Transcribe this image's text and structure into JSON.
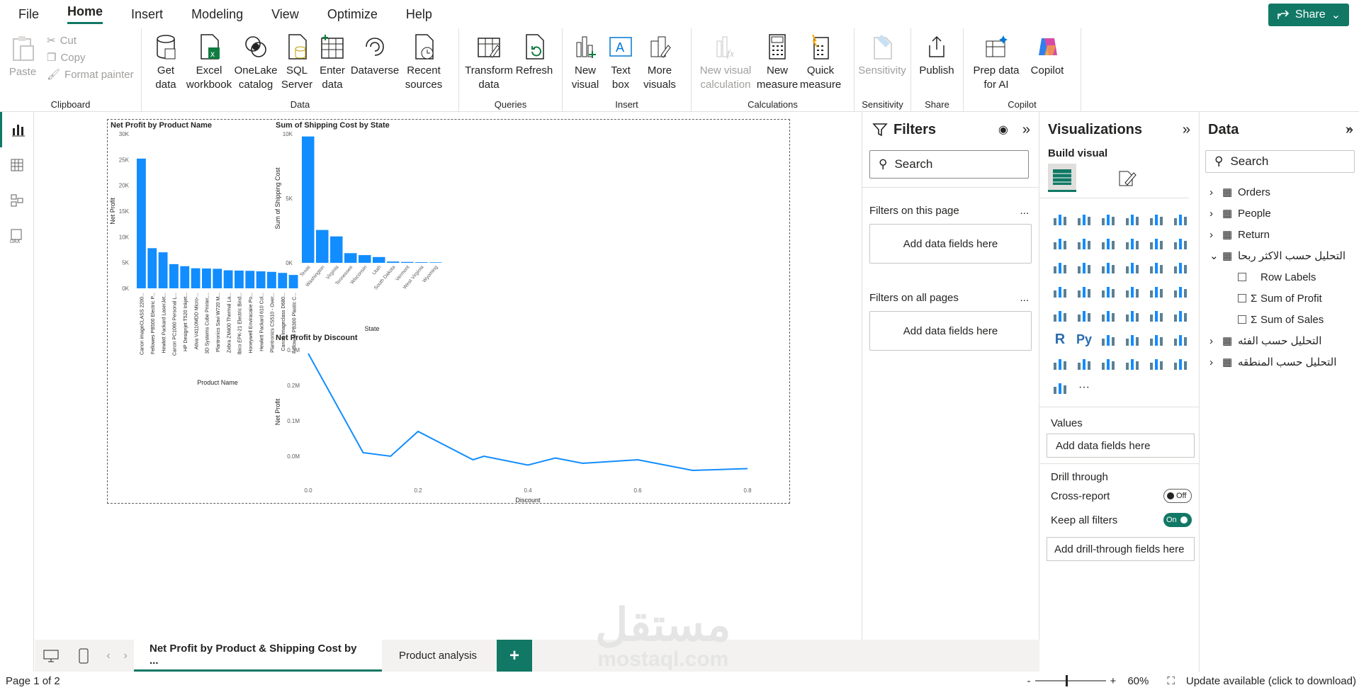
{
  "menu": [
    "File",
    "Home",
    "Insert",
    "Modeling",
    "View",
    "Optimize",
    "Help"
  ],
  "share_label": "Share",
  "ribbon": {
    "clipboard": {
      "paste": "Paste",
      "cut": "Cut",
      "copy": "Copy",
      "format_painter": "Format painter",
      "label": "Clipboard"
    },
    "data": {
      "get_data": "Get data",
      "excel": "Excel workbook",
      "onelake": "OneLake catalog",
      "sql": "SQL Server",
      "enter": "Enter data",
      "dataverse": "Dataverse",
      "recent": "Recent sources",
      "label": "Data"
    },
    "queries": {
      "transform": "Transform data",
      "refresh": "Refresh",
      "label": "Queries"
    },
    "insert": {
      "new_visual": "New visual",
      "text_box": "Text box",
      "more_visuals": "More visuals",
      "label": "Insert"
    },
    "calculations": {
      "new_visual_calc": "New visual calculation",
      "new_measure": "New measure",
      "quick_measure": "Quick measure",
      "label": "Calculations"
    },
    "sensitivity": {
      "sensitivity": "Sensitivity",
      "label": "Sensitivity"
    },
    "share": {
      "publish": "Publish",
      "label": "Share"
    },
    "copilot": {
      "prep": "Prep data for AI",
      "copilot": "Copilot",
      "label": "Copilot"
    }
  },
  "charts": {
    "c1_title": "Net Profit by Product Name",
    "c2_title": "Sum of Shipping Cost by State",
    "c3_title": "Net Profit by Discount"
  },
  "chart_data": [
    {
      "type": "bar",
      "title": "Net Profit by Product Name",
      "xlabel": "Product Name",
      "ylabel": "Net Profit",
      "ylim": [
        0,
        30000
      ],
      "yticks": [
        "0K",
        "5K",
        "10K",
        "15K",
        "20K",
        "25K",
        "30K"
      ],
      "categories": [
        "Canon imageCLASS 2200...",
        "Fellowes PB500 Electric P...",
        "Hewlett Packard LaserJet...",
        "Canon PC1060 Personal L...",
        "HP Designjet T520 Inkjet...",
        "Ativa V4110MDD Micro-...",
        "3D Systems Cube Printer,...",
        "Plantronics Savi W720 M...",
        "Zebra ZM400 Thermal La...",
        "Ibico EPK-21 Electric Bind...",
        "Honeywell Enviracaire Po...",
        "Hewlett Packard 610 Col...",
        "Plantronics CS510 - Over...",
        "Canon Imageclass D680...",
        "Fellowes PB300 Plastic C..."
      ],
      "values": [
        25200,
        7800,
        7000,
        4700,
        4300,
        3900,
        3850,
        3800,
        3500,
        3450,
        3400,
        3300,
        3200,
        3000,
        2600
      ]
    },
    {
      "type": "bar",
      "title": "Sum of Shipping Cost by State",
      "xlabel": "State",
      "ylabel": "Sum of Shipping Cost",
      "ylim": [
        0,
        10000
      ],
      "yticks": [
        "0K",
        "5K",
        "10K"
      ],
      "categories": [
        "Texas",
        "Washington",
        "Virginia",
        "Tennessee",
        "Wisconsin",
        "Utah",
        "South Dakota",
        "Vermont",
        "West Virginia",
        "Wyoming"
      ],
      "values": [
        9800,
        2550,
        2050,
        750,
        600,
        450,
        100,
        70,
        50,
        40
      ]
    },
    {
      "type": "line",
      "title": "Net Profit by Discount",
      "xlabel": "Discount",
      "ylabel": "Net Profit",
      "ylim": [
        -0.05,
        0.3
      ],
      "yticks": [
        "0.0M",
        "0.1M",
        "0.2M",
        "0.3M"
      ],
      "xticks": [
        "0.0",
        "0.2",
        "0.4",
        "0.6",
        "0.8"
      ],
      "x": [
        0.0,
        0.1,
        0.15,
        0.2,
        0.3,
        0.32,
        0.4,
        0.45,
        0.5,
        0.6,
        0.7,
        0.8
      ],
      "y": [
        0.29,
        0.01,
        0.0,
        0.07,
        -0.01,
        0.0,
        -0.025,
        -0.005,
        -0.02,
        -0.01,
        -0.04,
        -0.035
      ]
    }
  ],
  "filters": {
    "title": "Filters",
    "search": "Search",
    "on_page": "Filters on this page",
    "on_all": "Filters on all pages",
    "add": "Add data fields here",
    "more": "..."
  },
  "viz": {
    "title": "Visualizations",
    "build": "Build visual",
    "values": "Values",
    "add_values": "Add data fields here",
    "drill": "Drill through",
    "cross": "Cross-report",
    "cross_state": "Off",
    "keep": "Keep all filters",
    "keep_state": "On",
    "add_drill": "Add drill-through fields here",
    "r_label": "R",
    "py_label": "Py",
    "more": "···"
  },
  "data": {
    "title": "Data",
    "search": "Search",
    "tables": [
      "Orders",
      "People",
      "Return",
      "التحليل حسب الاكثر ربحا"
    ],
    "fields": [
      "Row Labels",
      "Sum of Profit",
      "Sum of Sales"
    ],
    "more_tables": [
      "التحليل حسب الفئه",
      "التحليل حسب المنطقه"
    ]
  },
  "tabs": {
    "t1": "Net Profit by Product & Shipping Cost by ...",
    "t2": "Product analysis",
    "add": "+"
  },
  "status": {
    "page": "Page 1 of 2",
    "zoom": "60%",
    "update": "Update available (click to download)",
    "minus": "-",
    "plus": "+"
  },
  "watermark": {
    "ar": "مستقل",
    "en": "mostaql.com"
  }
}
